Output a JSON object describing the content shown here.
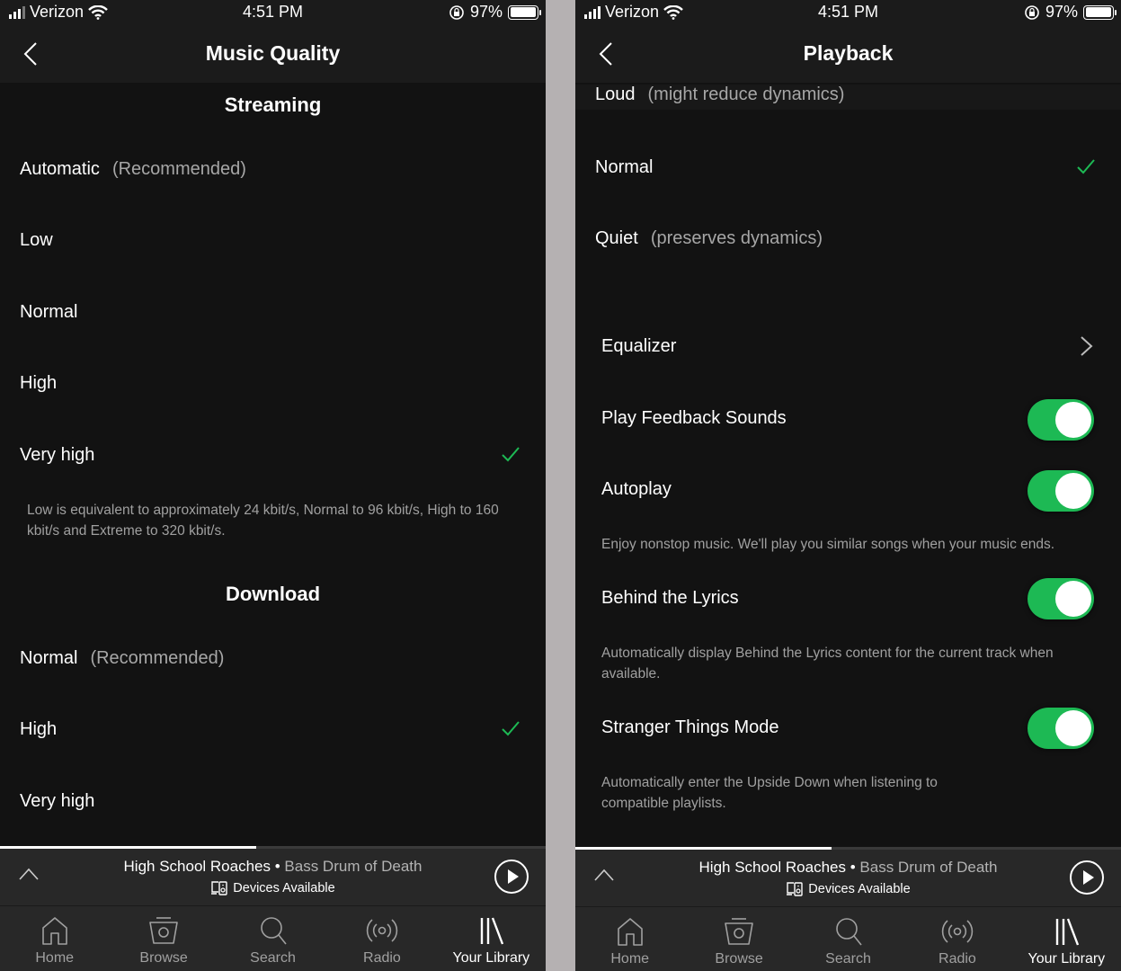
{
  "colors": {
    "accent": "#1db954",
    "background": "#121212",
    "bar": "#282828",
    "divider": "#b5b1b2"
  },
  "status_bar": {
    "carrier": "Verizon",
    "time": "4:51 PM",
    "battery": "97%"
  },
  "left_screen": {
    "title": "Music Quality",
    "streaming": {
      "heading": "Streaming",
      "options": [
        {
          "label": "Automatic",
          "note": "(Recommended)",
          "selected": false
        },
        {
          "label": "Low",
          "note": "",
          "selected": false
        },
        {
          "label": "Normal",
          "note": "",
          "selected": false
        },
        {
          "label": "High",
          "note": "",
          "selected": false
        },
        {
          "label": "Very high",
          "note": "",
          "selected": true
        }
      ],
      "description": "Low is equivalent to approximately 24 kbit/s, Normal to 96 kbit/s, High to 160 kbit/s and Extreme to 320 kbit/s."
    },
    "download": {
      "heading": "Download",
      "options": [
        {
          "label": "Normal",
          "note": "(Recommended)",
          "selected": false
        },
        {
          "label": "High",
          "note": "",
          "selected": true
        },
        {
          "label": "Very high",
          "note": "",
          "selected": false
        }
      ]
    },
    "progress_fraction": 0.47
  },
  "right_screen": {
    "title": "Playback",
    "volume_options": [
      {
        "label": "Loud",
        "note": "(might reduce dynamics)",
        "selected": false
      },
      {
        "label": "Normal",
        "note": "",
        "selected": true
      },
      {
        "label": "Quiet",
        "note": "(preserves dynamics)",
        "selected": false
      }
    ],
    "equalizer_label": "Equalizer",
    "toggles": [
      {
        "label": "Play Feedback Sounds",
        "on": true,
        "description": ""
      },
      {
        "label": "Autoplay",
        "on": true,
        "description": "Enjoy nonstop music. We'll play you similar songs when your music ends."
      },
      {
        "label": "Behind the Lyrics",
        "on": true,
        "description": "Automatically display Behind the Lyrics content for the current track when available."
      },
      {
        "label": "Stranger Things Mode",
        "on": true,
        "description": "Automatically enter the Upside Down when listening to compatible playlists."
      }
    ],
    "progress_fraction": 0.47
  },
  "now_playing": {
    "track": "High School Roaches",
    "separator": " • ",
    "artist": "Bass Drum of Death",
    "devices": "Devices Available"
  },
  "tabs": [
    {
      "label": "Home",
      "icon": "home-icon",
      "active": false
    },
    {
      "label": "Browse",
      "icon": "browse-icon",
      "active": false
    },
    {
      "label": "Search",
      "icon": "search-icon",
      "active": false
    },
    {
      "label": "Radio",
      "icon": "radio-icon",
      "active": false
    },
    {
      "label": "Your Library",
      "icon": "library-icon",
      "active": true
    }
  ]
}
